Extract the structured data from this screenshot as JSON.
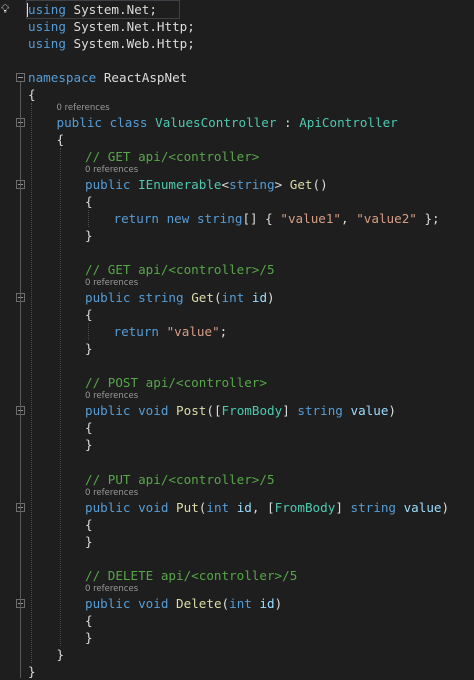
{
  "lightbulb_icon": "lightbulb-icon",
  "lines": [
    {
      "y": 0,
      "indent": 0,
      "tokens": [
        [
          "kw",
          "using"
        ],
        [
          "pl",
          " "
        ],
        [
          "pl",
          "System"
        ],
        [
          "pl",
          "."
        ],
        [
          "pl",
          "Net"
        ],
        [
          "pl",
          ";"
        ]
      ]
    },
    {
      "y": 1,
      "indent": 0,
      "tokens": [
        [
          "kw",
          "using"
        ],
        [
          "pl",
          " System.Net.Http;"
        ]
      ]
    },
    {
      "y": 2,
      "indent": 0,
      "tokens": [
        [
          "kw",
          "using"
        ],
        [
          "pl",
          " System.Web.Http;"
        ]
      ]
    },
    {
      "y": 4,
      "indent": 0,
      "tokens": [
        [
          "kw",
          "namespace"
        ],
        [
          "pl",
          " ReactAspNet"
        ]
      ]
    },
    {
      "y": 5,
      "indent": 0,
      "tokens": [
        [
          "pl",
          "{"
        ]
      ]
    },
    {
      "y": 6,
      "indent": 1,
      "tokens": [
        [
          "kw",
          "public"
        ],
        [
          "pl",
          " "
        ],
        [
          "kw",
          "class"
        ],
        [
          "pl",
          " "
        ],
        [
          "ty",
          "ValuesController"
        ],
        [
          "pl",
          " : "
        ],
        [
          "ty",
          "ApiController"
        ]
      ]
    },
    {
      "y": 7,
      "indent": 1,
      "tokens": [
        [
          "pl",
          "{"
        ]
      ]
    },
    {
      "y": 8,
      "indent": 2,
      "tokens": [
        [
          "cm",
          "// GET api/<controller>"
        ]
      ]
    },
    {
      "y": 9,
      "indent": 2,
      "tokens": [
        [
          "kw",
          "public"
        ],
        [
          "pl",
          " "
        ],
        [
          "ty",
          "IEnumerable"
        ],
        [
          "pl",
          "<"
        ],
        [
          "kw",
          "string"
        ],
        [
          "pl",
          "> "
        ],
        [
          "fn",
          "Get"
        ],
        [
          "pl",
          "()"
        ]
      ]
    },
    {
      "y": 10,
      "indent": 2,
      "tokens": [
        [
          "pl",
          "{"
        ]
      ]
    },
    {
      "y": 11,
      "indent": 3,
      "tokens": [
        [
          "kw",
          "return"
        ],
        [
          "pl",
          " "
        ],
        [
          "kw",
          "new"
        ],
        [
          "pl",
          " "
        ],
        [
          "kw",
          "string"
        ],
        [
          "pl",
          "[] { "
        ],
        [
          "st",
          "\"value1\""
        ],
        [
          "pl",
          ", "
        ],
        [
          "st",
          "\"value2\""
        ],
        [
          "pl",
          " };"
        ]
      ]
    },
    {
      "y": 12,
      "indent": 2,
      "tokens": [
        [
          "pl",
          "}"
        ]
      ]
    },
    {
      "y": 14,
      "indent": 2,
      "tokens": [
        [
          "cm",
          "// GET api/<controller>/5"
        ]
      ]
    },
    {
      "y": 15,
      "indent": 2,
      "tokens": [
        [
          "kw",
          "public"
        ],
        [
          "pl",
          " "
        ],
        [
          "kw",
          "string"
        ],
        [
          "pl",
          " "
        ],
        [
          "fn",
          "Get"
        ],
        [
          "pl",
          "("
        ],
        [
          "kw",
          "int"
        ],
        [
          "pl",
          " "
        ],
        [
          "pm",
          "id"
        ],
        [
          "pl",
          ")"
        ]
      ]
    },
    {
      "y": 16,
      "indent": 2,
      "tokens": [
        [
          "pl",
          "{"
        ]
      ]
    },
    {
      "y": 17,
      "indent": 3,
      "tokens": [
        [
          "kw",
          "return"
        ],
        [
          "pl",
          " "
        ],
        [
          "st",
          "\"value\""
        ],
        [
          "pl",
          ";"
        ]
      ]
    },
    {
      "y": 18,
      "indent": 2,
      "tokens": [
        [
          "pl",
          "}"
        ]
      ]
    },
    {
      "y": 20,
      "indent": 2,
      "tokens": [
        [
          "cm",
          "// POST api/<controller>"
        ]
      ]
    },
    {
      "y": 21,
      "indent": 2,
      "tokens": [
        [
          "kw",
          "public"
        ],
        [
          "pl",
          " "
        ],
        [
          "kw",
          "void"
        ],
        [
          "pl",
          " "
        ],
        [
          "fn",
          "Post"
        ],
        [
          "pl",
          "(["
        ],
        [
          "ty",
          "FromBody"
        ],
        [
          "pl",
          "] "
        ],
        [
          "kw",
          "string"
        ],
        [
          "pl",
          " "
        ],
        [
          "pm",
          "value"
        ],
        [
          "pl",
          ")"
        ]
      ]
    },
    {
      "y": 22,
      "indent": 2,
      "tokens": [
        [
          "pl",
          "{"
        ]
      ]
    },
    {
      "y": 23,
      "indent": 2,
      "tokens": [
        [
          "pl",
          "}"
        ]
      ]
    },
    {
      "y": 25,
      "indent": 2,
      "tokens": [
        [
          "cm",
          "// PUT api/<controller>/5"
        ]
      ]
    },
    {
      "y": 26,
      "indent": 2,
      "tokens": [
        [
          "kw",
          "public"
        ],
        [
          "pl",
          " "
        ],
        [
          "kw",
          "void"
        ],
        [
          "pl",
          " "
        ],
        [
          "fn",
          "Put"
        ],
        [
          "pl",
          "("
        ],
        [
          "kw",
          "int"
        ],
        [
          "pl",
          " "
        ],
        [
          "pm",
          "id"
        ],
        [
          "pl",
          ", ["
        ],
        [
          "ty",
          "FromBody"
        ],
        [
          "pl",
          "] "
        ],
        [
          "kw",
          "string"
        ],
        [
          "pl",
          " "
        ],
        [
          "pm",
          "value"
        ],
        [
          "pl",
          ")"
        ]
      ]
    },
    {
      "y": 27,
      "indent": 2,
      "tokens": [
        [
          "pl",
          "{"
        ]
      ]
    },
    {
      "y": 28,
      "indent": 2,
      "tokens": [
        [
          "pl",
          "}"
        ]
      ]
    },
    {
      "y": 30,
      "indent": 2,
      "tokens": [
        [
          "cm",
          "// DELETE api/<controller>/5"
        ]
      ]
    },
    {
      "y": 31,
      "indent": 2,
      "tokens": [
        [
          "kw",
          "public"
        ],
        [
          "pl",
          " "
        ],
        [
          "kw",
          "void"
        ],
        [
          "pl",
          " "
        ],
        [
          "fn",
          "Delete"
        ],
        [
          "pl",
          "("
        ],
        [
          "kw",
          "int"
        ],
        [
          "pl",
          " "
        ],
        [
          "pm",
          "id"
        ],
        [
          "pl",
          ")"
        ]
      ]
    },
    {
      "y": 32,
      "indent": 2,
      "tokens": [
        [
          "pl",
          "{"
        ]
      ]
    },
    {
      "y": 33,
      "indent": 2,
      "tokens": [
        [
          "pl",
          "}"
        ]
      ]
    },
    {
      "y": 34,
      "indent": 1,
      "tokens": [
        [
          "pl",
          "}"
        ]
      ]
    },
    {
      "y": 35,
      "indent": 0,
      "tokens": [
        [
          "pl",
          "}"
        ]
      ]
    }
  ],
  "references": [
    {
      "before": 6,
      "indent": 1,
      "text": "0 references"
    },
    {
      "before": 9,
      "indent": 2,
      "text": "0 references"
    },
    {
      "before": 15,
      "indent": 2,
      "text": "0 references"
    },
    {
      "before": 21,
      "indent": 2,
      "text": "0 references"
    },
    {
      "before": 26,
      "indent": 2,
      "text": "0 references"
    },
    {
      "before": 31,
      "indent": 2,
      "text": "0 references"
    }
  ],
  "colors": {
    "background": "#1e1e1e",
    "keyword": "#569cd6",
    "type": "#4ec9b0",
    "comment": "#57a64a",
    "string": "#d69d85",
    "method": "#dcdcaa",
    "parameter": "#9cdcfe",
    "plain": "#dcdcdc"
  }
}
